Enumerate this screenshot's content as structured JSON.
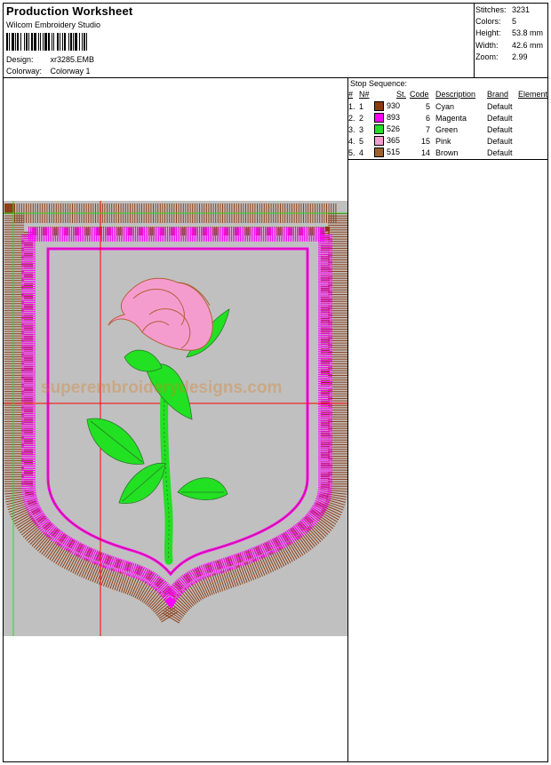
{
  "header": {
    "title": "Production Worksheet",
    "software": "Wilcom  Embroidery Studio",
    "design_label": "Design:",
    "design_value": "xr3285.EMB",
    "colorway_label": "Colorway:",
    "colorway_value": "Colorway 1"
  },
  "stats": {
    "stitches_label": "Stitches:",
    "stitches": "3231",
    "colors_label": "Colors:",
    "colors": "5",
    "height_label": "Height:",
    "height": "53.8 mm",
    "width_label": "Width:",
    "width": "42.6 mm",
    "zoom_label": "Zoom:",
    "zoom": "2.99"
  },
  "stop_sequence": {
    "title": "Stop Sequence:",
    "columns": [
      "#",
      "N#",
      "St.",
      "Code",
      "Description",
      "Brand",
      "Element"
    ],
    "rows": [
      {
        "num": "1.",
        "n": "1",
        "swatch": "#8b3a10",
        "code_id": "930",
        "st": "5",
        "description": "Cyan",
        "brand": "Default"
      },
      {
        "num": "2.",
        "n": "2",
        "swatch": "#ff00ff",
        "code_id": "893",
        "st": "6",
        "description": "Magenta",
        "brand": "Default"
      },
      {
        "num": "3.",
        "n": "3",
        "swatch": "#22e022",
        "code_id": "526",
        "st": "7",
        "description": "Green",
        "brand": "Default"
      },
      {
        "num": "4.",
        "n": "5",
        "swatch": "#f59ccf",
        "code_id": "365",
        "st": "15",
        "description": "Pink",
        "brand": "Default"
      },
      {
        "num": "5.",
        "n": "4",
        "swatch": "#a0602c",
        "code_id": "515",
        "st": "14",
        "description": "Brown",
        "brand": "Default"
      }
    ]
  },
  "watermark": "superembroiderydesigns.com",
  "colors": {
    "background": "#c0c0c0",
    "brown": "#8b3a10",
    "magenta": "#ff00ff",
    "green": "#22e022",
    "pink": "#f59ccf",
    "crosshair": "#ff0000"
  }
}
